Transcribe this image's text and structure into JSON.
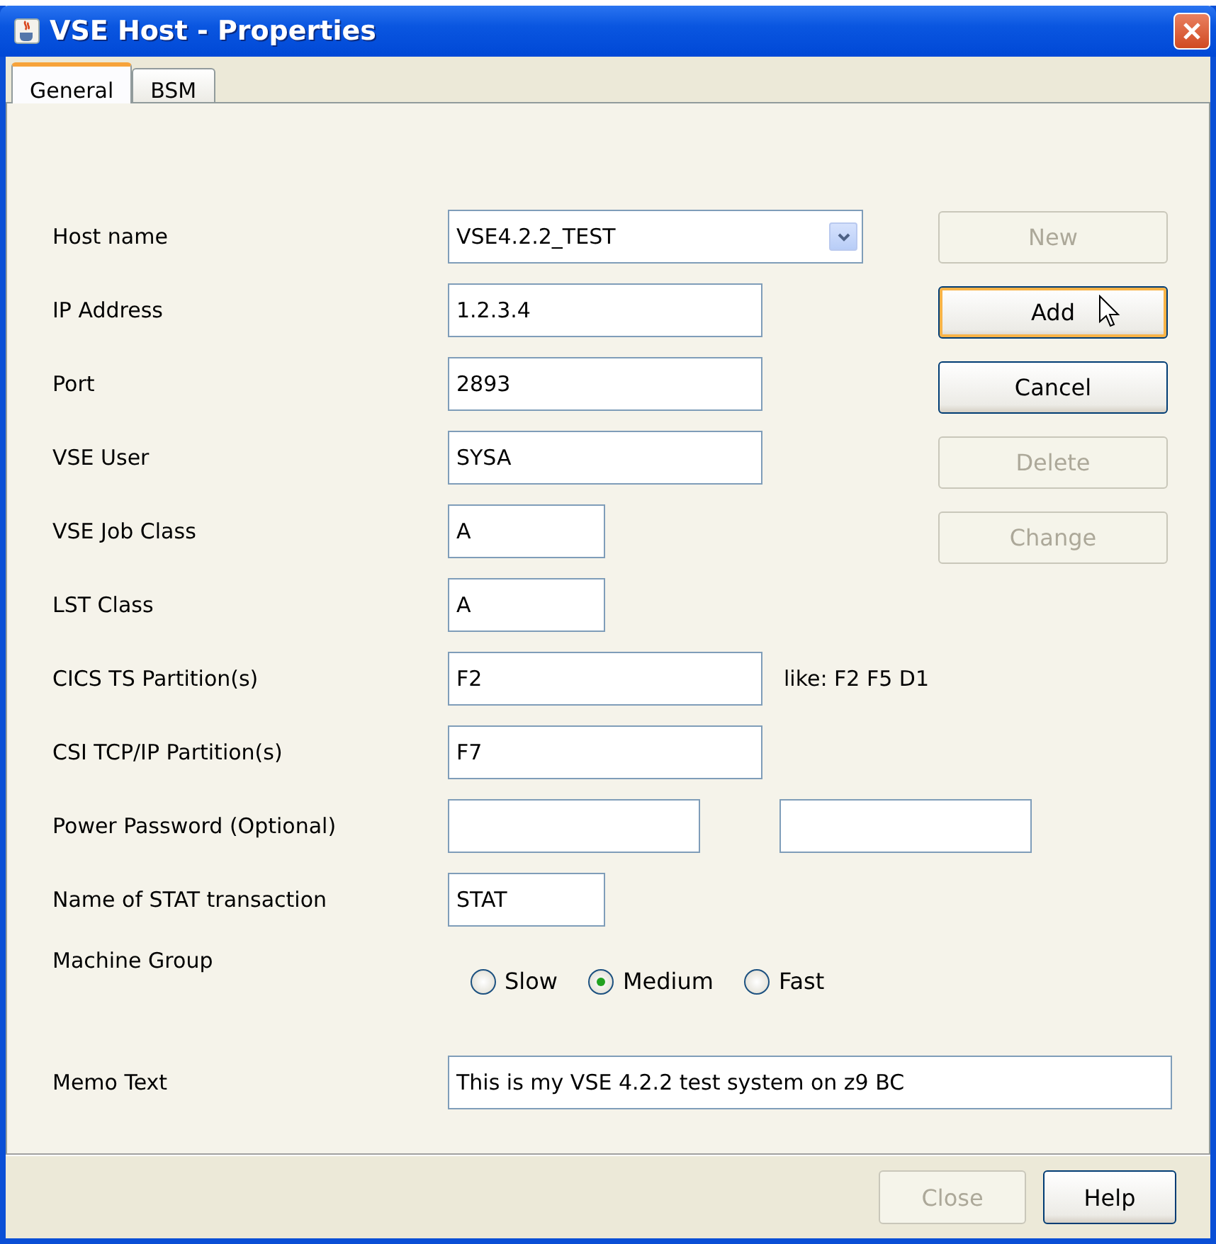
{
  "window": {
    "title": "VSE Host - Properties"
  },
  "tabs": [
    {
      "label": "General",
      "selected": true
    },
    {
      "label": "BSM",
      "selected": false
    }
  ],
  "rows": [
    {
      "kind": "combo",
      "label": "Host name",
      "value": "VSE4.2.2_TEST"
    },
    {
      "kind": "text",
      "label": "IP Address",
      "value": "1.2.3.4"
    },
    {
      "kind": "text",
      "label": "Port",
      "value": "2893"
    },
    {
      "kind": "text",
      "label": "VSE User",
      "value": "SYSA"
    },
    {
      "kind": "short",
      "label": "VSE Job Class",
      "value": "A"
    },
    {
      "kind": "short",
      "label": "LST Class",
      "value": "A"
    },
    {
      "kind": "text",
      "label": "CICS TS Partition(s)",
      "value": "F2",
      "hint": "like: F2 F5 D1"
    },
    {
      "kind": "text",
      "label": "CSI TCP/IP Partition(s)",
      "value": "F7"
    },
    {
      "kind": "pair",
      "label": "Power Password (Optional)"
    },
    {
      "kind": "short",
      "label": "Name of STAT transaction",
      "value": "STAT"
    },
    {
      "kind": "radio",
      "label": "Machine Group",
      "options": [
        {
          "label": "Slow",
          "selected": false
        },
        {
          "label": "Medium",
          "selected": true
        },
        {
          "label": "Fast",
          "selected": false
        }
      ]
    },
    {
      "kind": "memo",
      "label": "Memo Text",
      "value": "This is my VSE 4.2.2 test system on z9 BC"
    }
  ],
  "side_buttons": [
    {
      "label": "New",
      "disabled": true,
      "focused": false
    },
    {
      "label": "Add",
      "disabled": false,
      "focused": true
    },
    {
      "label": "Cancel",
      "disabled": false,
      "focused": false
    },
    {
      "label": "Delete",
      "disabled": true,
      "focused": false
    },
    {
      "label": "Change",
      "disabled": true,
      "focused": false
    }
  ],
  "footer_buttons": [
    {
      "label": "Close",
      "disabled": true
    },
    {
      "label": "Help",
      "disabled": false
    }
  ]
}
